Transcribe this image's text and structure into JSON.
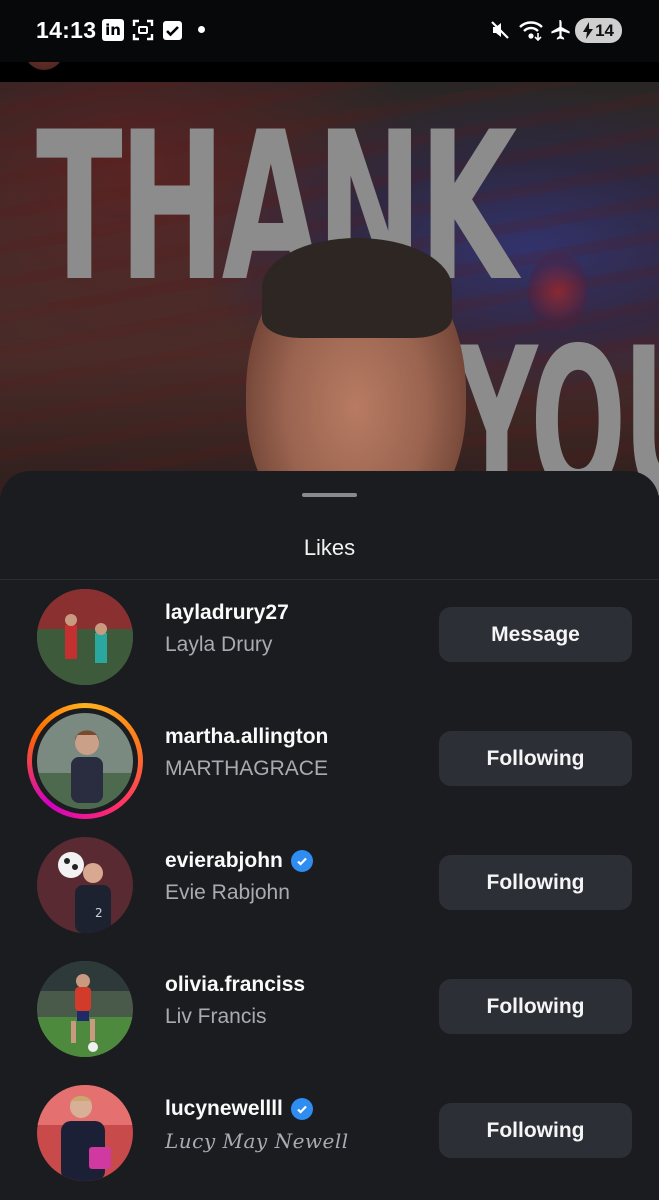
{
  "status_bar": {
    "time": "14:13",
    "battery": "14",
    "icons": [
      "linkedin-icon",
      "screenshot-scan-icon",
      "checkbox-icon",
      "notification-dot-icon",
      "mute-icon",
      "wifi-icon",
      "airplane-icon",
      "battery-icon"
    ],
    "linkedin_glyph": "in"
  },
  "post": {
    "headline_word1": "THANK",
    "headline_word2": "YOU"
  },
  "sheet": {
    "title": "Likes"
  },
  "likes": [
    {
      "username": "layladrury27",
      "fullname": "Layla Drury",
      "verified": false,
      "story_ring": false,
      "button": "Message"
    },
    {
      "username": "martha.allington",
      "fullname": "MARTHAGRACE",
      "verified": false,
      "story_ring": true,
      "button": "Following"
    },
    {
      "username": "evierabjohn",
      "fullname": "Evie Rabjohn",
      "verified": true,
      "story_ring": false,
      "button": "Following"
    },
    {
      "username": "olivia.franciss",
      "fullname": "Liv Francis",
      "verified": false,
      "story_ring": false,
      "button": "Following"
    },
    {
      "username": "lucynewellll",
      "fullname": "Lucy May Newell",
      "verified": true,
      "story_ring": false,
      "button": "Following"
    }
  ],
  "colors": {
    "sheet_bg": "#1b1c20",
    "button_bg": "#2d2f36",
    "verified_blue": "#2f8cf0",
    "secondary_text": "#a9abb0"
  }
}
